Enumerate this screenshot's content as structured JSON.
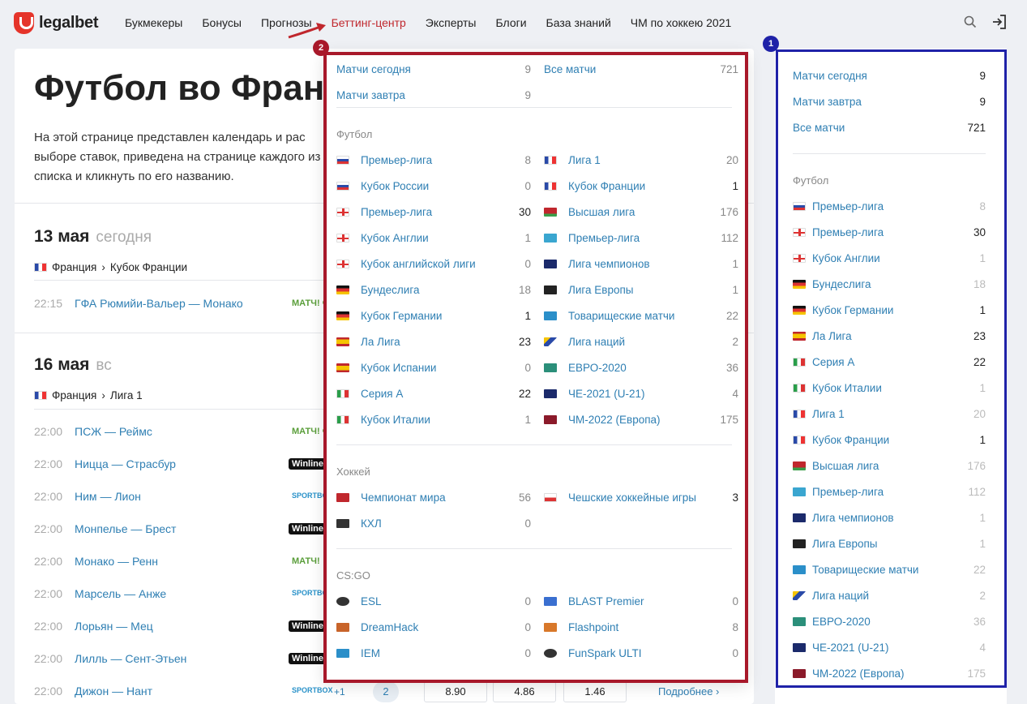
{
  "logo": "legalbet",
  "nav": [
    "Букмекеры",
    "Бонусы",
    "Прогнозы",
    "Беттинг-центр",
    "Эксперты",
    "Блоги",
    "База знаний",
    "ЧМ по хоккею 2021"
  ],
  "page": {
    "title": "Футбол во Фран",
    "intro": "На этой странице представлен календарь и рас выборе ставок, приведена на странице каждого из списка и кликнуть по его названию."
  },
  "days": [
    {
      "date": "13 мая",
      "sub": "сегодня",
      "country": "Франция",
      "league": "Кубок Франции",
      "matches": [
        {
          "time": "22:15",
          "teams": "ГФА Рюмийи-Вальер — Монако",
          "bk": "МАТЧ! ФУТБОЛ 2"
        }
      ]
    },
    {
      "date": "16 мая",
      "sub": "вс",
      "country": "Франция",
      "league": "Лига 1",
      "matches": [
        {
          "time": "22:00",
          "teams": "ПСЖ — Реймс",
          "bk": "МАТЧ! ФУТБОЛ"
        },
        {
          "time": "22:00",
          "teams": "Ницца — Страсбур",
          "bk": "Winline"
        },
        {
          "time": "22:00",
          "teams": "Ним — Лион",
          "bk": "SPORTBOX"
        },
        {
          "time": "22:00",
          "teams": "Монпелье — Брест",
          "bk": "Winline"
        },
        {
          "time": "22:00",
          "teams": "Монако — Ренн",
          "bk": "МАТЧ!"
        },
        {
          "time": "22:00",
          "teams": "Марсель — Анже",
          "bk": "SPORTBOX"
        },
        {
          "time": "22:00",
          "teams": "Лорьян — Мец",
          "bk": "Winline"
        },
        {
          "time": "22:00",
          "teams": "Лилль — Сент-Этьен",
          "bk": "Winline"
        },
        {
          "time": "22:00",
          "teams": "Дижон — Нант",
          "bk": "SPORTBOX"
        }
      ]
    }
  ],
  "bottom": {
    "plus": "+1",
    "pill": "2",
    "odds": [
      "8.90",
      "4.86",
      "1.46"
    ],
    "more": "Подробнее ›"
  },
  "annotations": {
    "sidebar": "1",
    "dropdown": "2"
  },
  "sidebar": {
    "top": [
      {
        "label": "Матчи сегодня",
        "count": "9"
      },
      {
        "label": "Матчи завтра",
        "count": "9"
      },
      {
        "label": "Все матчи",
        "count": "721"
      }
    ],
    "section": "Футбол",
    "items": [
      {
        "label": "Премьер-лига",
        "count": "8",
        "flag": "f-ru",
        "muted": true
      },
      {
        "label": "Премьер-лига",
        "count": "30",
        "flag": "f-en",
        "muted": false
      },
      {
        "label": "Кубок Англии",
        "count": "1",
        "flag": "f-en",
        "muted": true
      },
      {
        "label": "Бундеслига",
        "count": "18",
        "flag": "f-de",
        "muted": true
      },
      {
        "label": "Кубок Германии",
        "count": "1",
        "flag": "f-de",
        "muted": false
      },
      {
        "label": "Ла Лига",
        "count": "23",
        "flag": "f-es",
        "muted": false
      },
      {
        "label": "Серия А",
        "count": "22",
        "flag": "f-it",
        "muted": false
      },
      {
        "label": "Кубок Италии",
        "count": "1",
        "flag": "f-it",
        "muted": true
      },
      {
        "label": "Лига 1",
        "count": "20",
        "flag": "f-fr",
        "muted": true
      },
      {
        "label": "Кубок Франции",
        "count": "1",
        "flag": "f-fr",
        "muted": false
      },
      {
        "label": "Высшая лига",
        "count": "176",
        "flag": "f-by",
        "muted": true
      },
      {
        "label": "Премьер-лига",
        "count": "112",
        "flag": "f-kz",
        "muted": true
      },
      {
        "label": "Лига чемпионов",
        "count": "1",
        "flag": "f-cl",
        "muted": true
      },
      {
        "label": "Лига Европы",
        "count": "1",
        "flag": "f-el",
        "muted": true
      },
      {
        "label": "Товарищеские матчи",
        "count": "22",
        "flag": "f-fr2",
        "muted": true
      },
      {
        "label": "Лига наций",
        "count": "2",
        "flag": "f-nl",
        "muted": true
      },
      {
        "label": "ЕВРО-2020",
        "count": "36",
        "flag": "f-eu",
        "muted": true
      },
      {
        "label": "ЧЕ-2021 (U-21)",
        "count": "4",
        "flag": "f-u21",
        "muted": true
      },
      {
        "label": "ЧМ-2022 (Европа)",
        "count": "175",
        "flag": "f-wc",
        "muted": true
      }
    ]
  },
  "dropdown": {
    "top": [
      {
        "label": "Матчи сегодня",
        "count": "9"
      },
      {
        "label": "Все матчи",
        "count": "721"
      },
      {
        "label": "Матчи завтра",
        "count": "9"
      }
    ],
    "football_head": "Футбол",
    "football_left": [
      {
        "label": "Премьер-лига",
        "count": "8",
        "flag": "f-ru",
        "dark": false
      },
      {
        "label": "Кубок России",
        "count": "0",
        "flag": "f-ru",
        "dark": false
      },
      {
        "label": "Премьер-лига",
        "count": "30",
        "flag": "f-en",
        "dark": true
      },
      {
        "label": "Кубок Англии",
        "count": "1",
        "flag": "f-en",
        "dark": false
      },
      {
        "label": "Кубок английской лиги",
        "count": "0",
        "flag": "f-en",
        "dark": false
      },
      {
        "label": "Бундеслига",
        "count": "18",
        "flag": "f-de",
        "dark": false
      },
      {
        "label": "Кубок Германии",
        "count": "1",
        "flag": "f-de",
        "dark": true
      },
      {
        "label": "Ла Лига",
        "count": "23",
        "flag": "f-es",
        "dark": true
      },
      {
        "label": "Кубок Испании",
        "count": "0",
        "flag": "f-es",
        "dark": false
      },
      {
        "label": "Серия А",
        "count": "22",
        "flag": "f-it",
        "dark": true
      },
      {
        "label": "Кубок Италии",
        "count": "1",
        "flag": "f-it",
        "dark": false
      }
    ],
    "football_right": [
      {
        "label": "Лига 1",
        "count": "20",
        "flag": "f-fr",
        "dark": false
      },
      {
        "label": "Кубок Франции",
        "count": "1",
        "flag": "f-fr",
        "dark": true
      },
      {
        "label": "Высшая лига",
        "count": "176",
        "flag": "f-by",
        "dark": false
      },
      {
        "label": "Премьер-лига",
        "count": "112",
        "flag": "f-kz",
        "dark": false
      },
      {
        "label": "Лига чемпионов",
        "count": "1",
        "flag": "f-cl",
        "dark": false
      },
      {
        "label": "Лига Европы",
        "count": "1",
        "flag": "f-el",
        "dark": false
      },
      {
        "label": "Товарищеские матчи",
        "count": "22",
        "flag": "f-fr2",
        "dark": false
      },
      {
        "label": "Лига наций",
        "count": "2",
        "flag": "f-nl",
        "dark": false
      },
      {
        "label": "ЕВРО-2020",
        "count": "36",
        "flag": "f-eu",
        "dark": false
      },
      {
        "label": "ЧЕ-2021 (U-21)",
        "count": "4",
        "flag": "f-u21",
        "dark": false
      },
      {
        "label": "ЧМ-2022 (Европа)",
        "count": "175",
        "flag": "f-wc",
        "dark": false
      }
    ],
    "hockey_head": "Хоккей",
    "hockey_left": [
      {
        "label": "Чемпионат мира",
        "count": "56",
        "flag": "f-iihf",
        "dark": false
      },
      {
        "label": "КХЛ",
        "count": "0",
        "flag": "f-khl",
        "dark": false
      }
    ],
    "hockey_right": [
      {
        "label": "Чешские хоккейные игры",
        "count": "3",
        "flag": "f-cz",
        "dark": true
      }
    ],
    "csgo_head": "CS:GO",
    "csgo_left": [
      {
        "label": "ESL",
        "count": "0",
        "flag": "f-esl",
        "dark": false
      },
      {
        "label": "DreamHack",
        "count": "0",
        "flag": "f-dh",
        "dark": false
      },
      {
        "label": "IEM",
        "count": "0",
        "flag": "f-iem",
        "dark": false
      }
    ],
    "csgo_right": [
      {
        "label": "BLAST Premier",
        "count": "0",
        "flag": "f-blast",
        "dark": false
      },
      {
        "label": "Flashpoint",
        "count": "8",
        "flag": "f-fp",
        "dark": false
      },
      {
        "label": "FunSpark ULTI",
        "count": "0",
        "flag": "f-fs",
        "dark": false
      }
    ]
  },
  "colors": {
    "accent": "#c0272d",
    "link": "#2f7fb3",
    "frame_blue": "#1f22a8",
    "frame_red": "#a8182a"
  }
}
